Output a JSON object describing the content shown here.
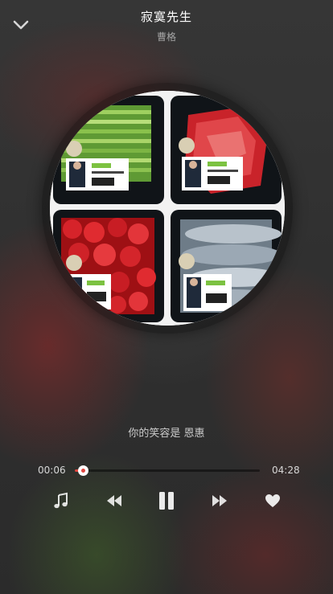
{
  "header": {
    "song_title": "寂寞先生",
    "artist": "曹格",
    "back_icon": "chevron-down-icon"
  },
  "album_art": {
    "description_icon": "album-cover-image"
  },
  "lyrics": {
    "current_line": "你的笑容是 恩惠"
  },
  "player": {
    "current_time": "00:06",
    "total_time": "04:28",
    "progress_fraction": 0.023,
    "accent_color": "#e0463f"
  },
  "controls": {
    "playlist_icon": "music-note-icon",
    "previous_icon": "rewind-icon",
    "play_pause_icon": "pause-icon",
    "next_icon": "fast-forward-icon",
    "like_icon": "heart-icon"
  }
}
